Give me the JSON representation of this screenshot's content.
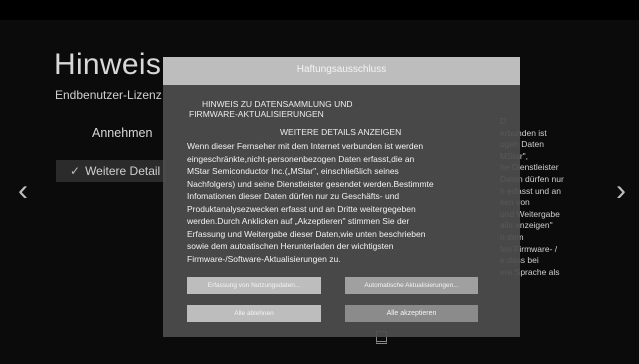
{
  "background": {
    "title": "Hinweis z",
    "subtitle": "Endbenutzer-Lizenz",
    "accept": "Annehmen",
    "more_details": "Weitere Detail",
    "more_check": "✓",
    "right_lines": [
      "D",
      "",
      "erbunden ist",
      "ogen Daten",
      "MStar\",",
      "he Dienstleister",
      "Daten dürfen nur",
      "h erfasst und an",
      "ken von",
      "und Weitergabe",
      "ails anzeigen\"",
      "n dem",
      "ten Firmware- /",
      "e,dass bei",
      "ere Sprache als"
    ],
    "left_arrow": "‹",
    "right_arrow": "›"
  },
  "dialog": {
    "title": "Haftungsausschluss",
    "notice_line1": "HINWEIS ZU DATENSAMMLUNG UND",
    "notice_line2": "FIRMWARE-AKTUALISIERUNGEN",
    "notice_line3": "",
    "notice_line4": "WEITERE DETAILS ANZEIGEN",
    "body_lines": [
      "Wenn dieser Fernseher mit dem Internet verbunden ist werden",
      "eingeschränkte,nicht-personenbezogen Daten erfasst,die an",
      "MStar Semiconductor Inc.(„MStar\", einschließlich seines",
      "Nachfolgers) und seine Dienstleister gesendet werden.Bestimmte",
      "Infomationen dieser Daten dürfen nur zu Geschäfts- und",
      "Produktanalysezwecken erfasst und an Dritte weitergegeben",
      "werden.Durch Anklicken auf „Akzeptieren\" stimmen Sie der",
      "Erfassung und Weitergabe dieser Daten,wie unten beschrieben",
      "sowie dem autoatischen Herunterladen der wichtigsten",
      "Firmware-/Software-Aktualisierungen zu."
    ],
    "btn_data_collection": "Erfassung von Nutzungsdaten...",
    "btn_auto_updates": "Automatische Aktualisierungen...",
    "btn_reject_all": "Alle ablehnen",
    "btn_accept_all": "Alle akzeptieren"
  }
}
